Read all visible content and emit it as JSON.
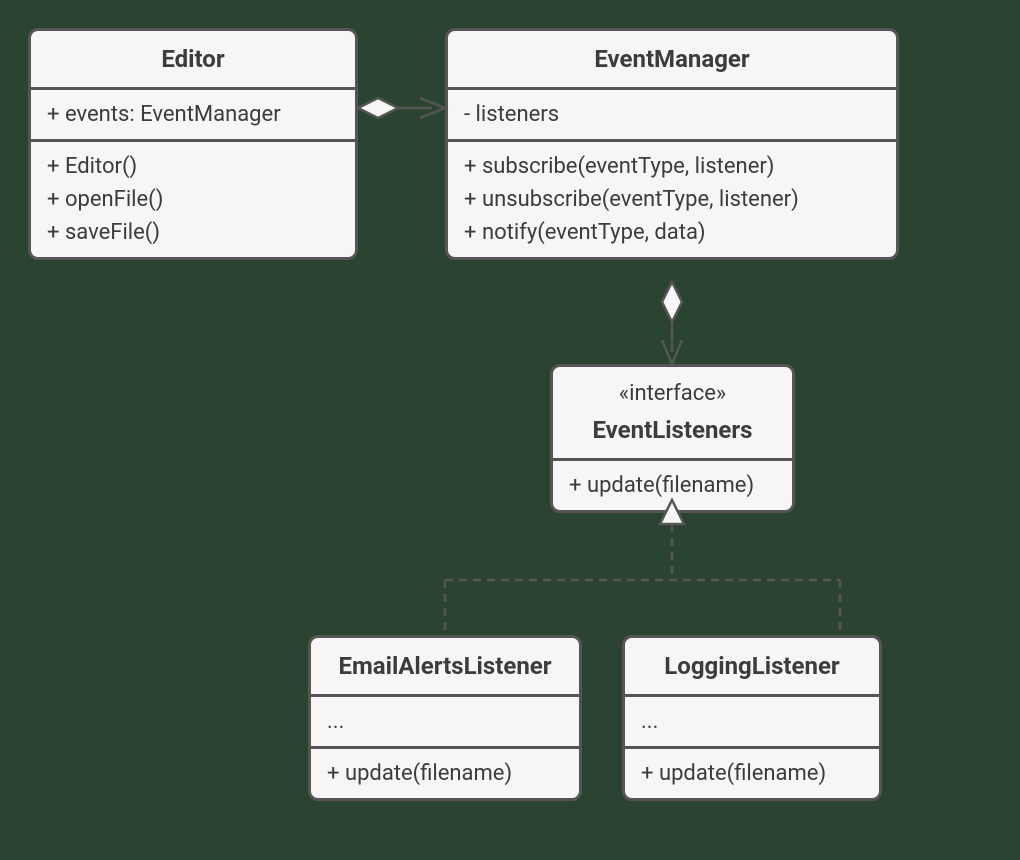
{
  "editor": {
    "title": "Editor",
    "attrs": [
      "+ events: EventManager"
    ],
    "methods": [
      "+ Editor()",
      "+ openFile()",
      "+ saveFile()"
    ]
  },
  "eventManager": {
    "title": "EventManager",
    "attrs": [
      "- listeners"
    ],
    "methods": [
      "+ subscribe(eventType, listener)",
      "+ unsubscribe(eventType, listener)",
      "+ notify(eventType, data)"
    ]
  },
  "eventListeners": {
    "stereotype": "«interface»",
    "title": "EventListeners",
    "methods": [
      "+ update(filename)"
    ]
  },
  "emailAlerts": {
    "title": "EmailAlertsListener",
    "attrs": [
      "..."
    ],
    "methods": [
      "+ update(filename)"
    ]
  },
  "logging": {
    "title": "LoggingListener",
    "attrs": [
      "..."
    ],
    "methods": [
      "+ update(filename)"
    ]
  }
}
